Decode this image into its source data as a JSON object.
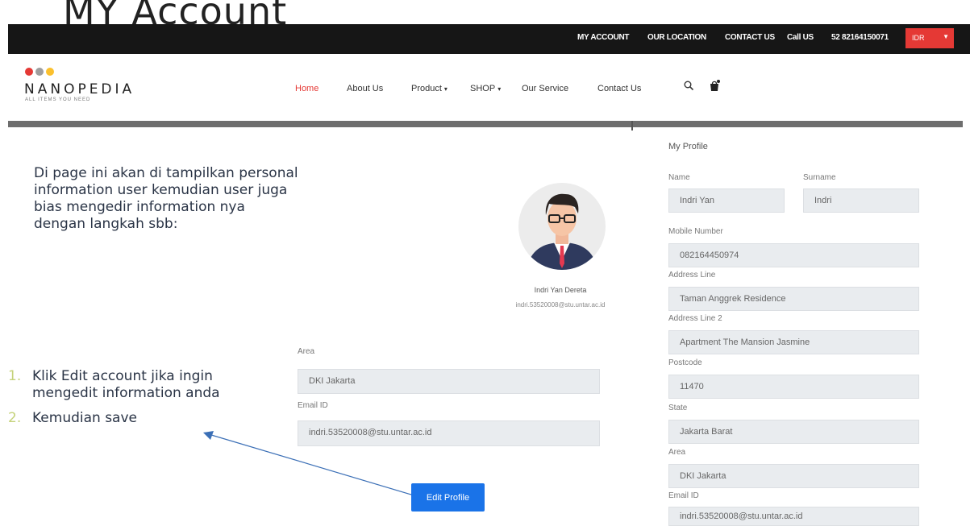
{
  "slide": {
    "title": "MY Account",
    "instructions": "Di page ini akan di tampilkan personal information user kemudian user juga bias mengedir information nya dengan langkah sbb:",
    "steps": [
      {
        "num": "1.",
        "text": "Klik Edit account jika ingin mengedit information anda"
      },
      {
        "num": "2.",
        "text": "Kemudian save"
      }
    ],
    "step_number_color": "#c5d27a",
    "arrow_color": "#3b6fb6"
  },
  "topbar": {
    "my_account": "MY ACCOUNT",
    "our_location": "OUR LOCATION",
    "contact_us": "CONTACT US",
    "call_us": "Call US",
    "phone": "52 82164150071",
    "currency": "IDR",
    "currency_color": "#e53935"
  },
  "logo": {
    "name": "NANOPEDIA",
    "tagline": "ALL ITEMS YOU NEED",
    "dot_colors": [
      "#e53935",
      "#9e9e9e",
      "#fbc02d"
    ]
  },
  "nav": {
    "home": "Home",
    "about": "About Us",
    "product": "Product",
    "shop": "SHOP",
    "service": "Our Service",
    "contact": "Contact Us",
    "search_icon": "search-icon",
    "cart_icon": "shopping-bag-icon"
  },
  "profile": {
    "name": "Indri Yan Dereta",
    "email": "indri.53520008@stu.untar.ac.id",
    "avatar_icon": "user-avatar-icon"
  },
  "left_form": {
    "area_label": "Area",
    "area_value": "DKI Jakarta",
    "email_label": "Email ID",
    "email_value": "indri.53520008@stu.untar.ac.id",
    "edit_button": "Edit Profile"
  },
  "right_form": {
    "heading": "My Profile",
    "name_label": "Name",
    "name_value": "Indri Yan",
    "surname_label": "Surname",
    "surname_value": "Indri",
    "mobile_label": "Mobile Number",
    "mobile_value": "082164450974",
    "address1_label": "Address Line",
    "address1_value": "Taman Anggrek Residence",
    "address2_label": "Address Line 2",
    "address2_value": "Apartment The Mansion Jasmine",
    "postcode_label": "Postcode",
    "postcode_value": "11470",
    "state_label": "State",
    "state_value": "Jakarta Barat",
    "area_label": "Area",
    "area_value": "DKI Jakarta",
    "email_label": "Email ID",
    "email_value": "indri.53520008@stu.untar.ac.id"
  }
}
